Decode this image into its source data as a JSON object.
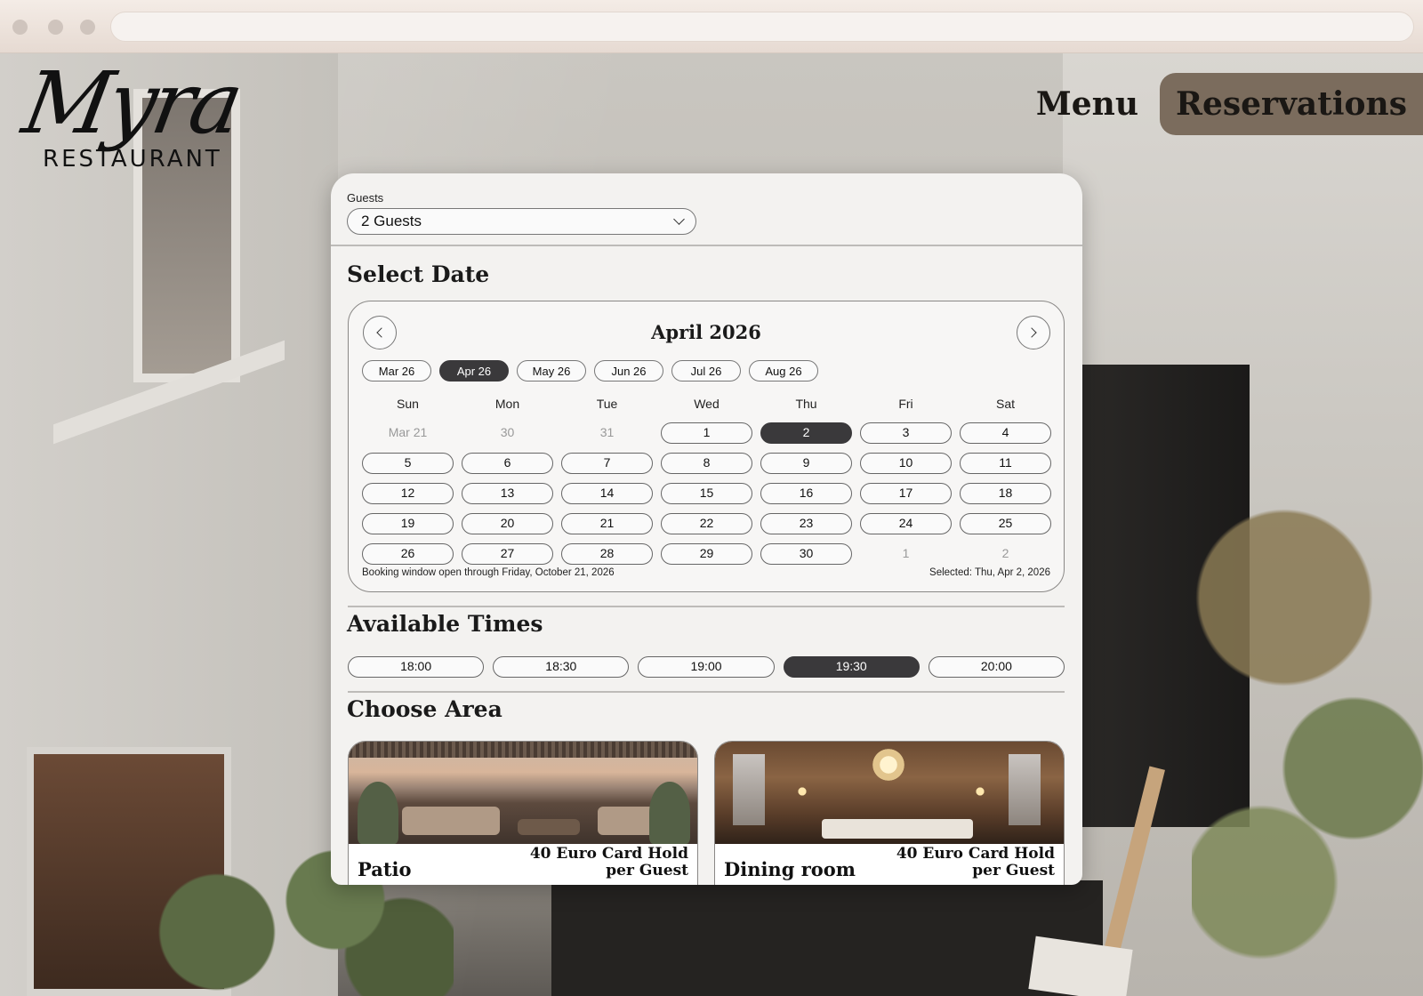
{
  "brand": {
    "script": "Myra",
    "subtitle": "Restaurant"
  },
  "nav": {
    "menu_label": "Menu",
    "reservations_label": "Reservations"
  },
  "guests": {
    "label": "Guests",
    "value": "2 Guests"
  },
  "date_section": {
    "title": "Select Date",
    "month_title": "April 2026",
    "month_pills": [
      {
        "label": "Mar 26",
        "active": false
      },
      {
        "label": "Apr 26",
        "active": true
      },
      {
        "label": "May 26",
        "active": false
      },
      {
        "label": "Jun 26",
        "active": false
      },
      {
        "label": "Jul 26",
        "active": false
      },
      {
        "label": "Aug 26",
        "active": false
      }
    ],
    "weekdays": [
      "Sun",
      "Mon",
      "Tue",
      "Wed",
      "Thu",
      "Fri",
      "Sat"
    ],
    "weeks": [
      [
        {
          "label": "Mar 21",
          "muted": true
        },
        {
          "label": "30",
          "muted": true
        },
        {
          "label": "31",
          "muted": true
        },
        {
          "label": "1"
        },
        {
          "label": "2",
          "selected": true
        },
        {
          "label": "3"
        },
        {
          "label": "4"
        }
      ],
      [
        {
          "label": "5"
        },
        {
          "label": "6"
        },
        {
          "label": "7"
        },
        {
          "label": "8"
        },
        {
          "label": "9"
        },
        {
          "label": "10"
        },
        {
          "label": "11"
        }
      ],
      [
        {
          "label": "12"
        },
        {
          "label": "13"
        },
        {
          "label": "14"
        },
        {
          "label": "15"
        },
        {
          "label": "16"
        },
        {
          "label": "17"
        },
        {
          "label": "18"
        }
      ],
      [
        {
          "label": "19"
        },
        {
          "label": "20"
        },
        {
          "label": "21"
        },
        {
          "label": "22"
        },
        {
          "label": "23"
        },
        {
          "label": "24"
        },
        {
          "label": "25"
        }
      ],
      [
        {
          "label": "26"
        },
        {
          "label": "27"
        },
        {
          "label": "28"
        },
        {
          "label": "29"
        },
        {
          "label": "30"
        },
        {
          "label": "1",
          "muted": true
        },
        {
          "label": "2",
          "muted": true
        }
      ]
    ],
    "booking_window_note": "Booking window open through Friday, October 21, 2026",
    "selected_note": "Selected: Thu, Apr 2, 2026"
  },
  "times_section": {
    "title": "Available Times",
    "times": [
      {
        "label": "18:00",
        "active": false
      },
      {
        "label": "18:30",
        "active": false
      },
      {
        "label": "19:00",
        "active": false
      },
      {
        "label": "19:30",
        "active": true
      },
      {
        "label": "20:00",
        "active": false
      }
    ]
  },
  "area_section": {
    "title": "Choose Area",
    "areas": [
      {
        "name": "Patio",
        "price": "40 Euro Card Hold per Guest",
        "image": "patio-photo"
      },
      {
        "name": "Dining room",
        "price": "40 Euro Card Hold per Guest",
        "image": "dining-room-photo"
      }
    ]
  },
  "colors": {
    "accent_dark": "#3a393b",
    "nav_active_bg": "#7b6c5d",
    "panel_bg": "#f3f2f0"
  }
}
